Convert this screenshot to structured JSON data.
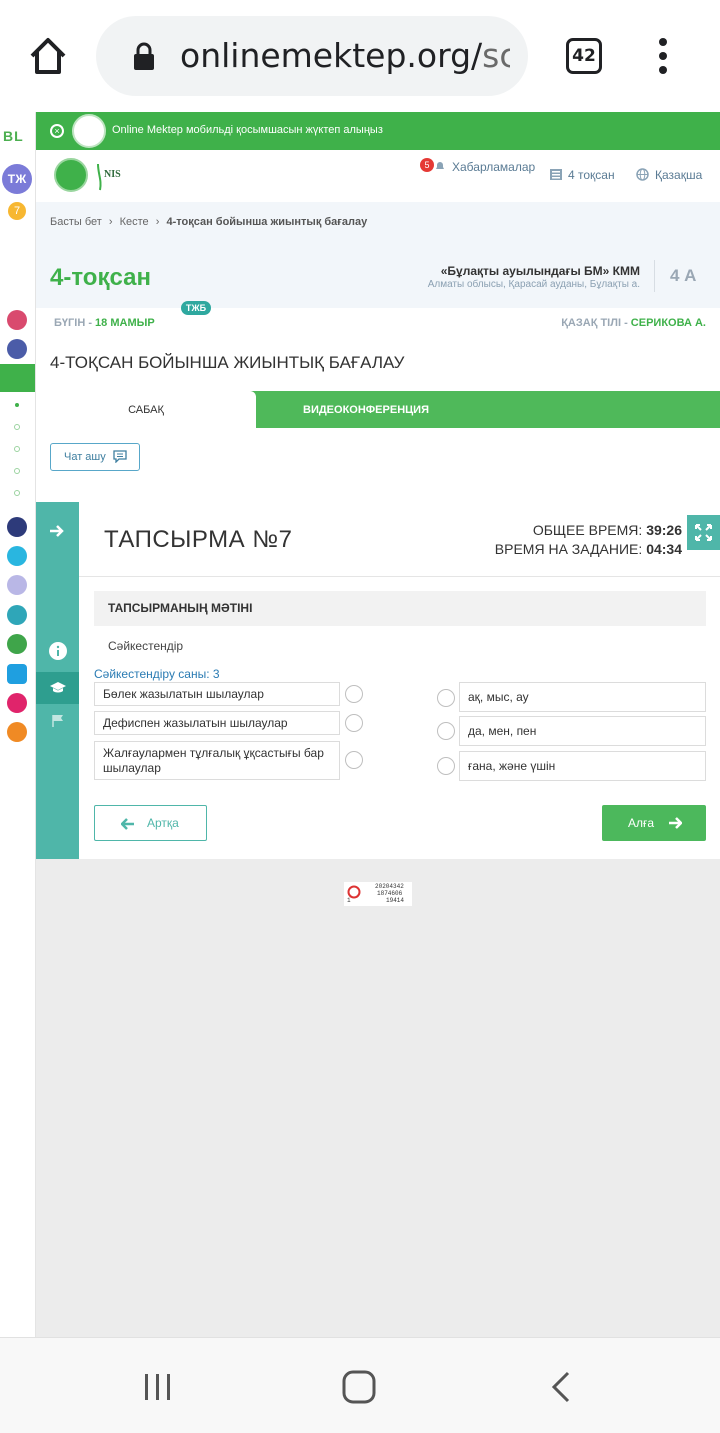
{
  "browser": {
    "url_main": "onlinemektep.org/",
    "url_tail": "sc",
    "tab_count": "42"
  },
  "rail": {
    "brand": "BL",
    "avatar": "ТЖ",
    "counter": "7"
  },
  "banner": {
    "text": "Online Mektep мобильді қосымшасын жүктеп алыңыз"
  },
  "topnav": {
    "notifications_count": "5",
    "notifications_label": "Хабарламалар",
    "quarter_label": "4 тоқсан",
    "language_label": "Қазақша"
  },
  "breadcrumb": {
    "home": "Басты бет",
    "schedule": "Кесте",
    "current": "4-тоқсан бойынша жиынтық бағалау"
  },
  "header": {
    "quarter_title": "4-тоқсан",
    "school_name": "«Бұлақты ауылындағы БМ» КММ",
    "school_region": "Алматы облысы, Қарасай ауданы, Бұлақты а.",
    "class": "4 А"
  },
  "dateband": {
    "today_label": "БҮГІН - ",
    "today_date": "18 МАМЫР",
    "badge": "ТЖБ",
    "subject_label": "ҚАЗАҚ ТІЛІ - ",
    "teacher": "СЕРИКОВА А."
  },
  "lesson": {
    "title": "4-ТОҚСАН БОЙЫНША ЖИЫНТЫҚ БАҒАЛАУ",
    "tab_lesson": "САБАҚ",
    "tab_video": "ВИДЕОКОНФЕРЕНЦИЯ",
    "chat_button": "Чат ашу"
  },
  "task": {
    "title": "ТАПСЫРМА №7",
    "total_time_label": "ОБЩЕЕ ВРЕМЯ: ",
    "total_time_value": "39:26",
    "task_time_label": "ВРЕМЯ НА ЗАДАНИЕ: ",
    "task_time_value": "04:34",
    "text_header": "ТАПСЫРМАНЫҢ МӘТІНІ",
    "prompt": "Сәйкестендір",
    "match_count": "Сәйкестендіру саны: 3",
    "left_items": [
      "Бөлек жазылатын шылаулар",
      "Дефиспен жазылатын шылаулар",
      "Жалғаулармен тұлғалық ұқсастығы бар шылаулар"
    ],
    "right_items": [
      "ақ, мыс, ау",
      "да, мен, пен",
      "ғана, және үшін"
    ],
    "back_button": "Артқа",
    "next_button": "Алға"
  },
  "counter_widget": {
    "line1": "20204342",
    "line2": "1874606",
    "line3": "1",
    "line4": "19414"
  },
  "colors": {
    "brand_green": "#3fb14a",
    "teal": "#4fb6a9",
    "link_blue": "#2a7bb3"
  }
}
